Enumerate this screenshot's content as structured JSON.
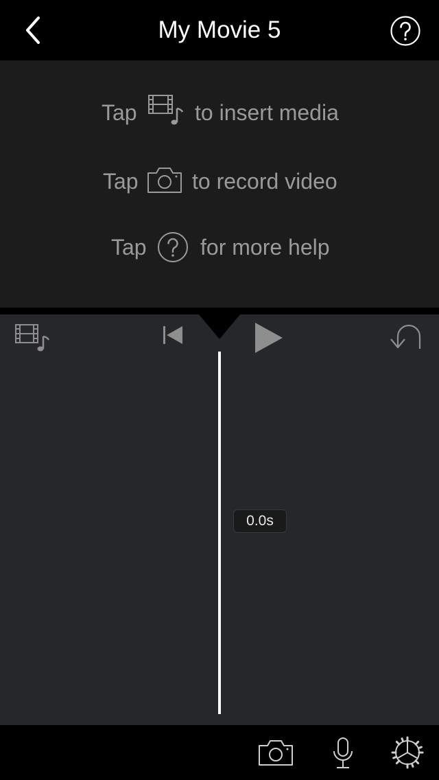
{
  "header": {
    "title": "My Movie 5"
  },
  "hints": [
    {
      "prefix": "Tap",
      "icon": "media-icon",
      "suffix": "to insert media"
    },
    {
      "prefix": "Tap",
      "icon": "camera-icon",
      "suffix": "to record video"
    },
    {
      "prefix": "Tap",
      "icon": "question-icon",
      "suffix": "for more help"
    }
  ],
  "timeline": {
    "time_label": "0.0s"
  },
  "colors": {
    "viewer_bg": "#1c1c1d",
    "timeline_bg": "#262729",
    "hint_text": "#9a9a9a",
    "icon_gray": "#8e8e8e"
  }
}
